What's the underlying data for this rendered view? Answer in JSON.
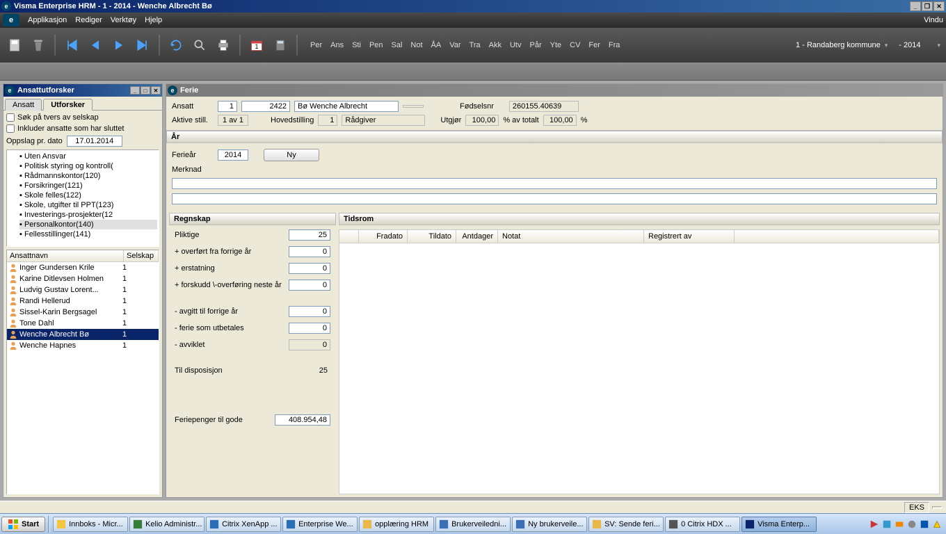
{
  "window": {
    "title": "Visma Enterprise HRM - 1 - 2014 - Wenche Albrecht Bø"
  },
  "menu": {
    "items": [
      "Applikasjon",
      "Rediger",
      "Verktøy",
      "Hjelp"
    ],
    "right": "Vindu"
  },
  "toolbar": {
    "textbtns": [
      "Per",
      "Ans",
      "Sti",
      "Pen",
      "Sal",
      "Not",
      "ÅA",
      "Var",
      "Tra",
      "Akk",
      "Utv",
      "Pår",
      "Yte",
      "CV",
      "Fer",
      "Fra"
    ],
    "company": "1 - Randaberg kommune",
    "year": "- 2014"
  },
  "sidebar": {
    "title": "Ansattutforsker",
    "tabs": {
      "ansatt": "Ansatt",
      "utforsker": "Utforsker"
    },
    "chk_cross": "Søk på tvers av selskap",
    "chk_ended": "Inkluder ansatte som har sluttet",
    "date_label": "Oppslag pr. dato",
    "date_value": "17.01.2014",
    "tree": [
      "Uten Ansvar",
      "Politisk styring og kontroll(",
      "Rådmannskontor(120)",
      "Forsikringer(121)",
      "Skole felles(122)",
      "Skole, utgifter til PPT(123)",
      "Investerings-prosjekter(12",
      "Personalkontor(140)",
      "Fellesstillinger(141)"
    ],
    "list_hdr": {
      "name": "Ansattnavn",
      "company": "Selskap"
    },
    "employees": [
      {
        "name": "Inger Gundersen Krile",
        "comp": "1"
      },
      {
        "name": "Karine Ditlevsen Holmen",
        "comp": "1"
      },
      {
        "name": "Ludvig Gustav Lorent...",
        "comp": "1"
      },
      {
        "name": "Randi Hellerud",
        "comp": "1"
      },
      {
        "name": "Sissel-Karin Bergsagel",
        "comp": "1"
      },
      {
        "name": "Tone Dahl",
        "comp": "1"
      },
      {
        "name": "Wenche Albrecht Bø",
        "comp": "1"
      },
      {
        "name": "Wenche Hapnes",
        "comp": "1"
      }
    ]
  },
  "main": {
    "title": "Ferie",
    "ansatt_lbl": "Ansatt",
    "ansatt_id": "1",
    "ansatt_no": "2422",
    "ansatt_name": "Bø Wenche Albrecht",
    "fn_lbl": "Fødselsnr",
    "fn_val": "260155.40639",
    "aktive_lbl": "Aktive still.",
    "aktive_val": "1 av 1",
    "hoved_lbl": "Hovedstilling",
    "hoved_no": "1",
    "hoved_title": "Rådgiver",
    "utgjor_lbl": "Utgjør",
    "utgjor_pct": "100,00",
    "pct_txt": "% av totalt",
    "total_pct": "100,00",
    "pct2": "%",
    "ar_hdr": "År",
    "feriear_lbl": "Ferieår",
    "feriear_val": "2014",
    "ny_btn": "Ny",
    "merknad_lbl": "Merknad",
    "regnskap_hdr": "Regnskap",
    "reg_rows": {
      "pliktige": "Pliktige",
      "pliktige_v": "25",
      "forrige": "+ overført fra forrige år",
      "forrige_v": "0",
      "erstat": "+ erstatning",
      "erstat_v": "0",
      "forskudd": "+ forskudd \\-overføring neste år",
      "forskudd_v": "0",
      "avgitt": "- avgitt til forrige år",
      "avgitt_v": "0",
      "utbet": "- ferie som utbetales",
      "utbet_v": "0",
      "avviklet": "- avviklet",
      "avviklet_v": "0",
      "disp": "Til disposisjon",
      "disp_v": "25",
      "penger": "Feriepenger til gode",
      "penger_v": "408.954,48"
    },
    "tidsrom_hdr": "Tidsrom",
    "tcols": {
      "fra": "Fradato",
      "til": "Tildato",
      "ant": "Antdager",
      "notat": "Notat",
      "reg": "Registrert av"
    }
  },
  "status": {
    "eks": "EKS"
  },
  "taskbar": {
    "start": "Start",
    "items": [
      "Innboks - Micr...",
      "Kelio Administr...",
      "Citrix XenApp ...",
      "Enterprise We...",
      "opplæring HRM",
      "Brukerveiledni...",
      "Ny brukerveile...",
      "SV: Sende feri...",
      "0 Citrix HDX ...",
      "Visma Enterp..."
    ]
  }
}
